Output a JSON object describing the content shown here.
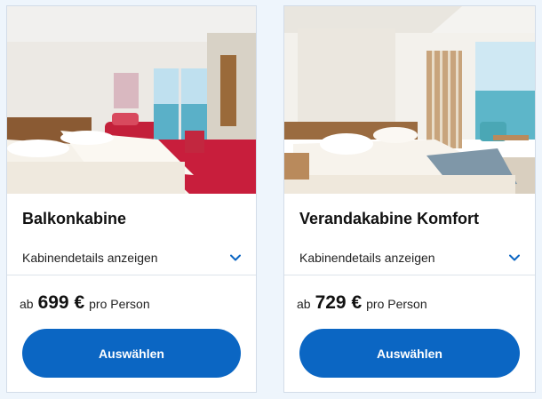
{
  "colors": {
    "accent": "#0b66c3",
    "page_background": "#eef5fc",
    "chevron": "#0b66c3"
  },
  "cabins": [
    {
      "title": "Balkonkabine",
      "details_label": "Kabinendetails anzeigen",
      "price_prefix": "ab",
      "price": "699 €",
      "price_suffix": "pro Person",
      "button_label": "Auswählen",
      "details_icon": "chevron-down-icon"
    },
    {
      "title": "Verandakabine Komfort",
      "details_label": "Kabinendetails anzeigen",
      "price_prefix": "ab",
      "price": "729 €",
      "price_suffix": "pro Person",
      "button_label": "Auswählen",
      "details_icon": "chevron-down-icon"
    }
  ]
}
